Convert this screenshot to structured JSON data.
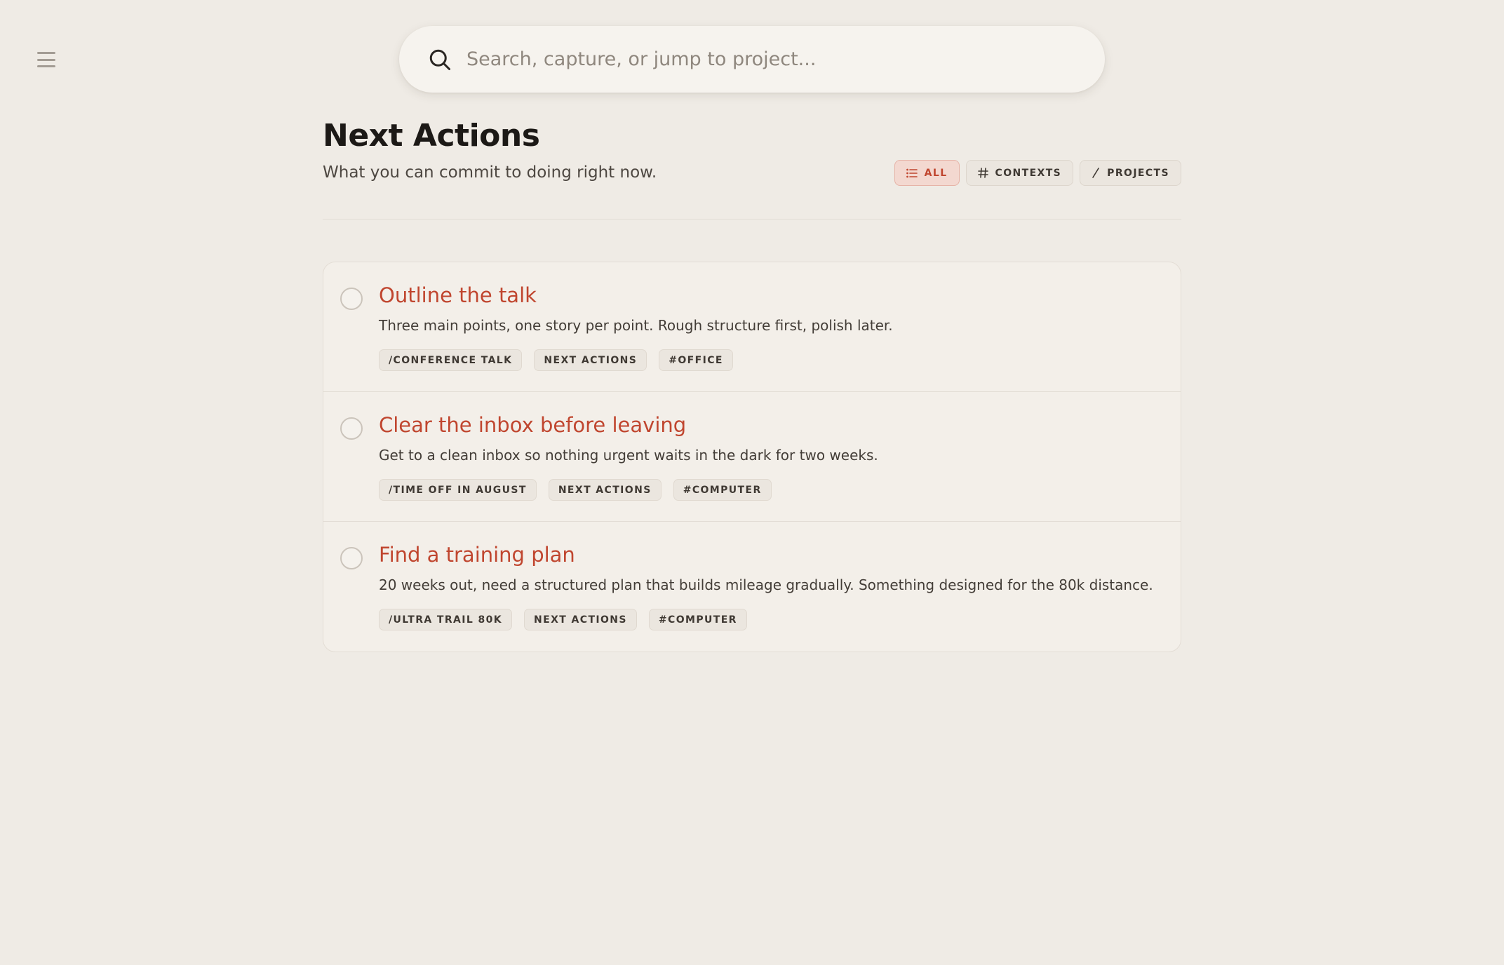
{
  "search": {
    "placeholder": "Search, capture, or jump to project..."
  },
  "header": {
    "title": "Next Actions",
    "subtitle": "What you can commit to doing right now."
  },
  "filters": [
    {
      "label": "ALL",
      "icon": "list-icon",
      "active": true
    },
    {
      "label": "CONTEXTS",
      "icon": "hash-icon",
      "active": false
    },
    {
      "label": "PROJECTS",
      "icon": "slash-icon",
      "active": false
    }
  ],
  "tasks": [
    {
      "title": "Outline the talk",
      "description": "Three main points, one story per point. Rough structure first, polish later.",
      "tags": [
        "/CONFERENCE TALK",
        "NEXT ACTIONS",
        "#OFFICE"
      ]
    },
    {
      "title": "Clear the inbox before leaving",
      "description": "Get to a clean inbox so nothing urgent waits in the dark for two weeks.",
      "tags": [
        "/TIME OFF IN AUGUST",
        "NEXT ACTIONS",
        "#COMPUTER"
      ]
    },
    {
      "title": "Find a training plan",
      "description": "20 weeks out, need a structured plan that builds mileage gradually. Something designed for the 80k distance.",
      "tags": [
        "/ULTRA TRAIL 80K",
        "NEXT ACTIONS",
        "#COMPUTER"
      ]
    }
  ],
  "colors": {
    "background": "#efebe5",
    "accent": "#c0462f",
    "card": "#f3efe9"
  }
}
